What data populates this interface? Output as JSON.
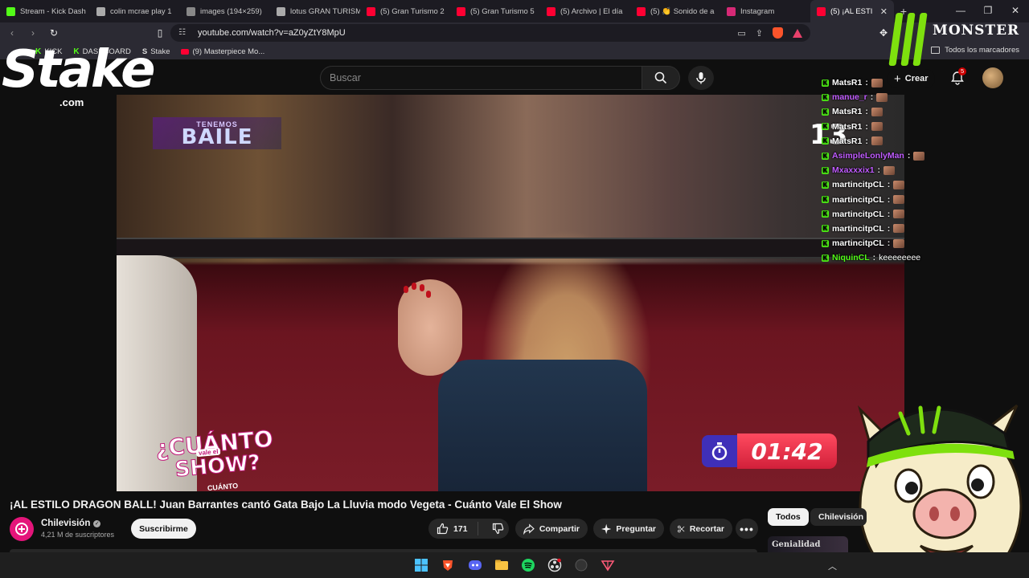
{
  "browser": {
    "tabs": [
      {
        "label": "Stream - Kick Dash",
        "favicon_color": "#53fc18"
      },
      {
        "label": "colin mcrae play 1",
        "favicon_color": "#aaaaaa"
      },
      {
        "label": "images (194×259)",
        "favicon_color": "#888888"
      },
      {
        "label": "lotus GRAN TURISM",
        "favicon_color": "#aaaaaa"
      },
      {
        "label": "(5) Gran Turismo 2",
        "favicon_color": "#ff0033"
      },
      {
        "label": "(5) Gran Turismo 5",
        "favicon_color": "#ff0033"
      },
      {
        "label": "(5) Archivo | El día",
        "favicon_color": "#ff0033"
      },
      {
        "label": "(5) 👏 Sonido de a",
        "favicon_color": "#ff0033"
      },
      {
        "label": "Instagram",
        "favicon_color": "#d62976"
      },
      {
        "label": "(5) ¡AL ESTI",
        "favicon_color": "#ff0033"
      }
    ],
    "active_tab": 9,
    "url": "youtube.com/watch?v=aZ0yZtY8MpU",
    "bookmarks": [
      {
        "label": "KICK",
        "icon": "kick"
      },
      {
        "label": "DASHBOARD",
        "icon": "kick"
      },
      {
        "label": "Stake",
        "icon": "stake"
      },
      {
        "label": "(9) Masterpiece Mo...",
        "icon": "youtube"
      }
    ],
    "all_bookmarks_label": "Todos los marcadores"
  },
  "youtube": {
    "search_placeholder": "Buscar",
    "create_label": "Crear",
    "notifications_count": "5"
  },
  "video": {
    "title": "¡AL ESTILO DRAGON BALL! Juan Barrantes cantó Gata Bajo La Lluvia modo Vegeta - Cuánto Vale El Show",
    "overlay_program_small": "TENEMOS",
    "overlay_program": "BAILE",
    "show_logo": {
      "line1": "¿CUÁNTO",
      "badge": "vale el",
      "line2": "SHOW?",
      "line3": "CUÁNTO"
    },
    "timer": "01:42",
    "channel_mark": "13"
  },
  "channel": {
    "name": "Chilevisión",
    "subscribers": "4,21 M de suscriptores",
    "subscribe_label": "Suscribirme"
  },
  "actions": {
    "likes": "171",
    "share": "Compartir",
    "ask": "Preguntar",
    "clip": "Recortar"
  },
  "sidebar": {
    "chips": [
      "Todos",
      "Chilevisión"
    ],
    "thumb_text": "Genialidad"
  },
  "overlays": {
    "stake_word": "Stake",
    "stake_com": ".com",
    "monster_text": "MONSTER"
  },
  "chat": [
    {
      "user": "MatsR1",
      "color": "#ffffff",
      "msg": ""
    },
    {
      "user": "manue_r",
      "color": "#c05cff",
      "msg": ""
    },
    {
      "user": "MatsR1",
      "color": "#ffffff",
      "msg": ""
    },
    {
      "user": "MatsR1",
      "color": "#ffffff",
      "msg": ""
    },
    {
      "user": "MatsR1",
      "color": "#ffffff",
      "msg": ""
    },
    {
      "user": "AsimpleLonlyMan",
      "color": "#c05cff",
      "msg": ""
    },
    {
      "user": "Mxaxxxix1",
      "color": "#c05cff",
      "msg": ""
    },
    {
      "user": "martincitpCL",
      "color": "#ffffff",
      "msg": ""
    },
    {
      "user": "martincitpCL",
      "color": "#ffffff",
      "msg": ""
    },
    {
      "user": "martincitpCL",
      "color": "#ffffff",
      "msg": ""
    },
    {
      "user": "martincitpCL",
      "color": "#ffffff",
      "msg": ""
    },
    {
      "user": "martincitpCL",
      "color": "#ffffff",
      "msg": ""
    },
    {
      "user": "NiquinCL",
      "color": "#53fc18",
      "msg": "keeeeeeee"
    }
  ],
  "colors": {
    "kick_green": "#53fc18",
    "youtube_red": "#ff0033",
    "chilevision_pink": "#e4157a",
    "monster_green": "#7ee00e"
  }
}
